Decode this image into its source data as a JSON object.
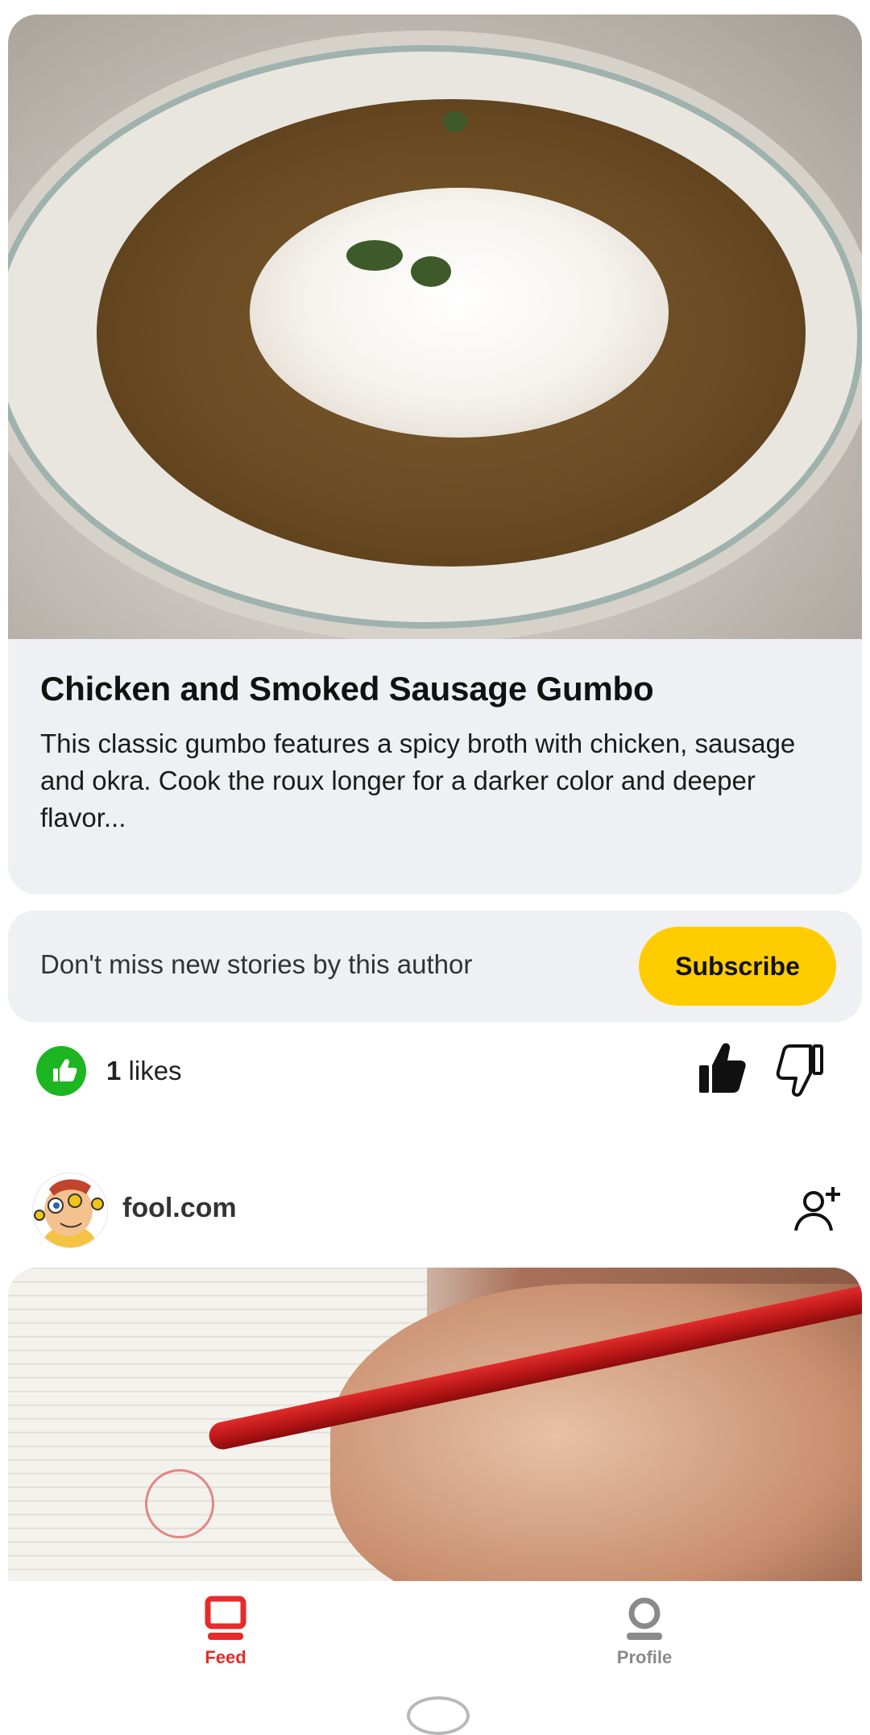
{
  "post": {
    "title": "Chicken and Smoked Sausage Gumbo",
    "description": "This classic gumbo features a spicy broth with chicken, sausage and okra. Cook the roux longer for a darker color and deeper flavor..."
  },
  "subscribe": {
    "prompt": "Don't miss new stories by this author",
    "button_label": "Subscribe"
  },
  "reactions": {
    "likes_number": "1",
    "likes_suffix": "likes",
    "icons": [
      "thumbs-up-badge-icon",
      "like-icon",
      "dislike-icon"
    ]
  },
  "next_post": {
    "source": "fool.com",
    "icons": [
      "avatar",
      "follow-icon"
    ]
  },
  "bottom_nav": {
    "items": [
      {
        "label": "Feed",
        "icon": "feed-icon",
        "active": true
      },
      {
        "label": "Profile",
        "icon": "profile-icon",
        "active": false
      }
    ]
  },
  "colors": {
    "accent_yellow": "#ffcc00",
    "like_green": "#1db522",
    "active_red": "#e52b2b",
    "card_bg": "#eff0f3"
  }
}
